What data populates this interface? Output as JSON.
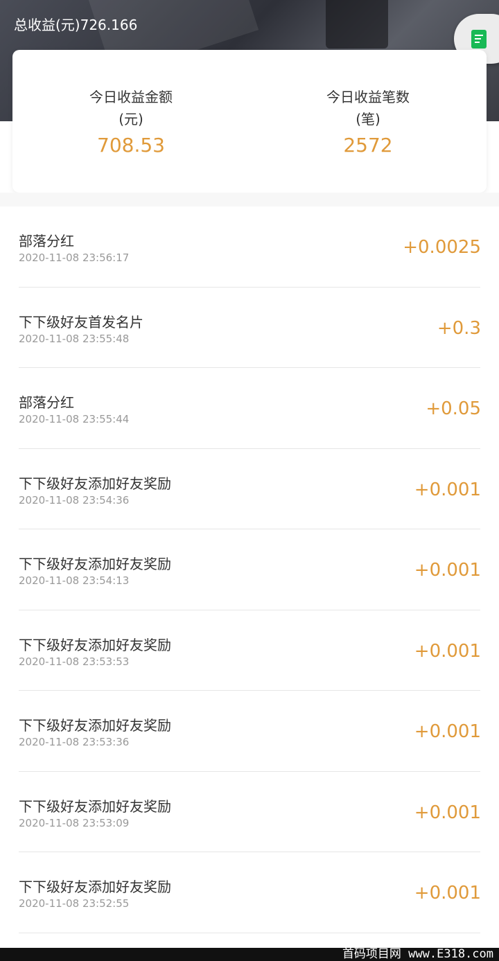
{
  "header": {
    "total_label": "总收益(元)726.166"
  },
  "summary": {
    "amount_label_line1": "今日收益金额",
    "amount_label_line2": "(元)",
    "amount_value": "708.53",
    "count_label_line1": "今日收益笔数",
    "count_label_line2": "(笔)",
    "count_value": "2572"
  },
  "records": [
    {
      "title": "部落分红",
      "time": "2020-11-08 23:56:17",
      "amount": "+0.0025"
    },
    {
      "title": "下下级好友首发名片",
      "time": "2020-11-08 23:55:48",
      "amount": "+0.3"
    },
    {
      "title": "部落分红",
      "time": "2020-11-08 23:55:44",
      "amount": "+0.05"
    },
    {
      "title": "下下级好友添加好友奖励",
      "time": "2020-11-08 23:54:36",
      "amount": "+0.001"
    },
    {
      "title": "下下级好友添加好友奖励",
      "time": "2020-11-08 23:54:13",
      "amount": "+0.001"
    },
    {
      "title": "下下级好友添加好友奖励",
      "time": "2020-11-08 23:53:53",
      "amount": "+0.001"
    },
    {
      "title": "下下级好友添加好友奖励",
      "time": "2020-11-08 23:53:36",
      "amount": "+0.001"
    },
    {
      "title": "下下级好友添加好友奖励",
      "time": "2020-11-08 23:53:09",
      "amount": "+0.001"
    },
    {
      "title": "下下级好友添加好友奖励",
      "time": "2020-11-08 23:52:55",
      "amount": "+0.001"
    }
  ],
  "watermark": "首码项目网 www.E318.com",
  "colors": {
    "accent": "#e09a3a",
    "float_icon": "#19b955"
  },
  "icons": {
    "float_button": "document-icon"
  }
}
